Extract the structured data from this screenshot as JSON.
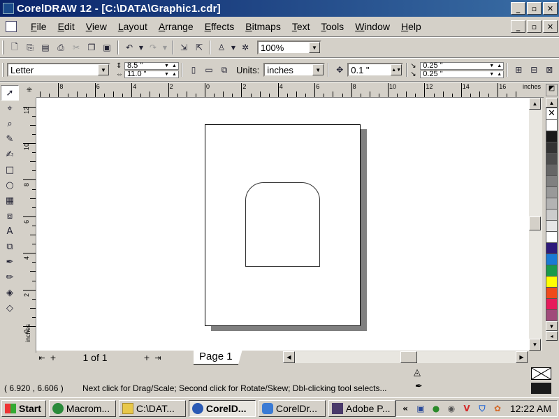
{
  "window": {
    "title": "CorelDRAW 12 - [C:\\DATA\\Graphic1.cdr]",
    "min": "_",
    "restore": "▫",
    "close": "✕"
  },
  "menu": [
    "File",
    "Edit",
    "View",
    "Layout",
    "Arrange",
    "Effects",
    "Bitmaps",
    "Text",
    "Tools",
    "Window",
    "Help"
  ],
  "standard_toolbar": {
    "zoom_value": "100%"
  },
  "property_bar": {
    "paper_type": "Letter",
    "width": "8.5 \"",
    "height": "11.0 \"",
    "units_label": "Units:",
    "units_value": "inches",
    "nudge": "0.1 \"",
    "dup_x": "0.25 \"",
    "dup_y": "0.25 \""
  },
  "rulers": {
    "unit": "inches",
    "h_labels": [
      "8",
      "6",
      "4",
      "2",
      "0",
      "2",
      "4",
      "6",
      "8",
      "10",
      "12",
      "14",
      "16"
    ],
    "v_labels": [
      "12",
      "10",
      "8",
      "6",
      "4",
      "2",
      "0"
    ],
    "v_unit": "inches"
  },
  "page_nav": {
    "counter": "1 of 1",
    "tab": "Page 1"
  },
  "status": {
    "coords": "( 6.920 , 6.606  )",
    "message": "Next click for Drag/Scale; Second click for Rotate/Skew; Dbl-clicking tool selects..."
  },
  "palette_colors": [
    "#ffffff",
    "#1a1a1a",
    "#333333",
    "#4d4d4d",
    "#666666",
    "#808080",
    "#999999",
    "#b3b3b3",
    "#cccccc",
    "#e6e6e6",
    "#ffffff",
    "#2e1a7a",
    "#1a7ad4",
    "#1a9a4a",
    "#ffff00",
    "#f04a1a",
    "#e61a5a",
    "#a04a7a"
  ],
  "taskbar": {
    "start": "Start",
    "tasks": [
      "Macrom...",
      "C:\\DAT...",
      "CorelD...",
      "CorelDr...",
      "Adobe P..."
    ],
    "clock": "12:22 AM",
    "tray_chevron": "«",
    "tray_v": "V"
  }
}
